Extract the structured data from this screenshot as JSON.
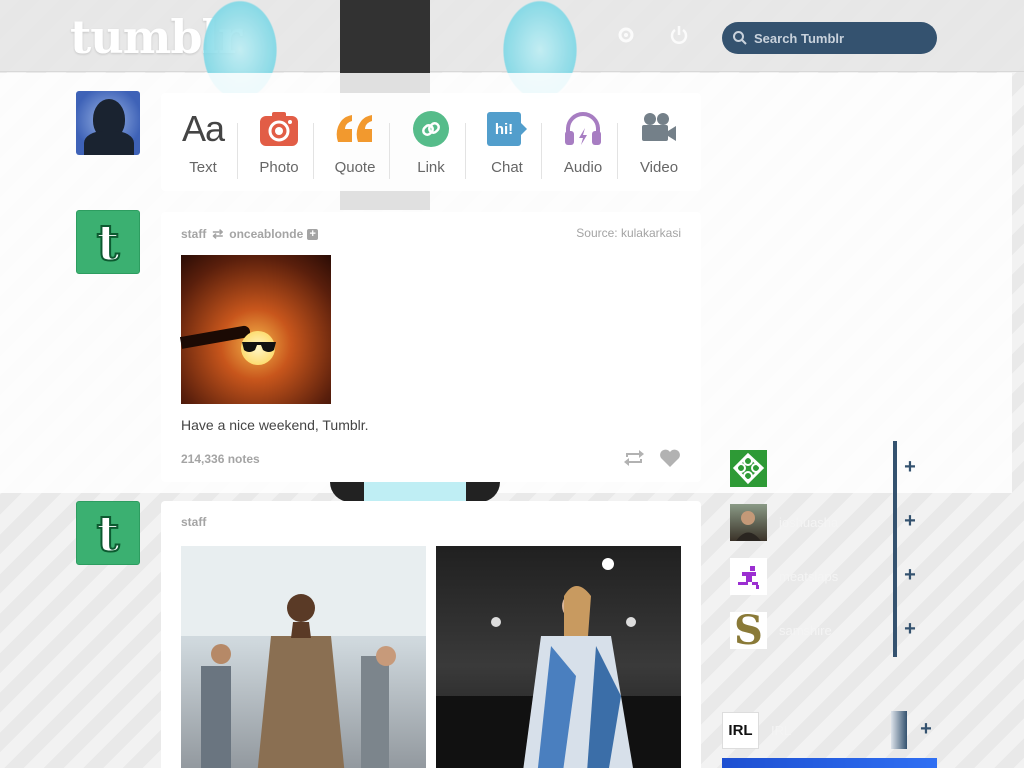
{
  "header": {
    "logo": "tumblr",
    "search_placeholder": "Search Tumblr",
    "icons": [
      "gear-icon",
      "power-icon"
    ]
  },
  "post_types": [
    {
      "label": "Text",
      "icon": "text-icon",
      "color": "#444444"
    },
    {
      "label": "Photo",
      "icon": "camera-icon",
      "color": "#e25d46"
    },
    {
      "label": "Quote",
      "icon": "quote-icon",
      "color": "#f2992e"
    },
    {
      "label": "Link",
      "icon": "link-icon",
      "color": "#56bc8a"
    },
    {
      "label": "Chat",
      "icon": "chat-icon",
      "color": "#529ecc"
    },
    {
      "label": "Audio",
      "icon": "headphones-icon",
      "color": "#a77dc2"
    },
    {
      "label": "Video",
      "icon": "video-camera-icon",
      "color": "#748089"
    }
  ],
  "posts": [
    {
      "author": "staff",
      "reblogged_from": "onceablonde",
      "source_label": "Source:",
      "source": "kulakarkasi",
      "caption": "Have a nice weekend, Tumblr.",
      "notes": "214,336 notes"
    },
    {
      "author": "staff"
    }
  ],
  "sidebar": {
    "recommended": [
      {
        "name": "",
        "avatar": "green-knot-avatar"
      },
      {
        "name": "joshuasha",
        "avatar": "person-avatar"
      },
      {
        "name": "meatslaps",
        "avatar": "pixel-runner-avatar"
      },
      {
        "name": "samshire",
        "avatar": "letter-s-avatar"
      },
      {
        "name": "IRL",
        "avatar": "irl-avatar"
      }
    ]
  },
  "colors": {
    "accent": "#34526f",
    "tumblr_green": "#3bb071"
  }
}
